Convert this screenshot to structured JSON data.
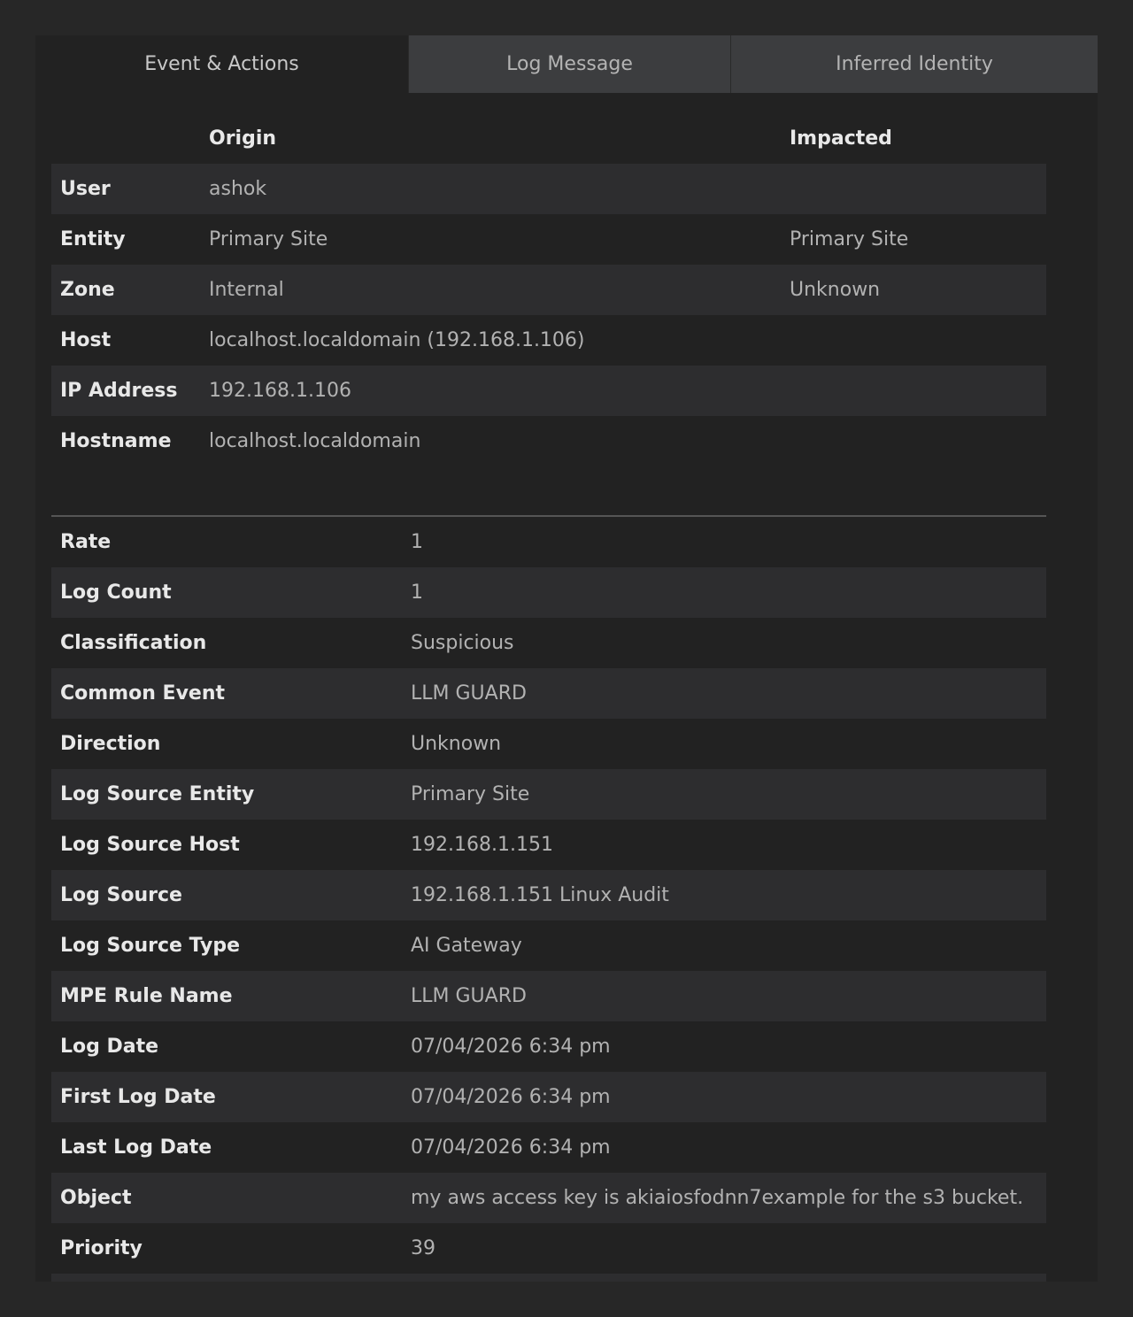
{
  "tabs": [
    {
      "label": "Event & Actions",
      "active": true
    },
    {
      "label": "Log Message",
      "active": false
    },
    {
      "label": "Inferred Identity",
      "active": false
    }
  ],
  "identity_table": {
    "headers": {
      "origin": "Origin",
      "impacted": "Impacted"
    },
    "rows": [
      {
        "label": "User",
        "origin": "ashok",
        "impacted": ""
      },
      {
        "label": "Entity",
        "origin": "Primary Site",
        "impacted": "Primary Site"
      },
      {
        "label": "Zone",
        "origin": "Internal",
        "impacted": "Unknown"
      },
      {
        "label": "Host",
        "origin": "localhost.localdomain (192.168.1.106)",
        "impacted": ""
      },
      {
        "label": "IP Address",
        "origin": "192.168.1.106",
        "impacted": ""
      },
      {
        "label": "Hostname",
        "origin": "localhost.localdomain",
        "impacted": ""
      }
    ]
  },
  "details_table": {
    "rows": [
      {
        "label": "Rate",
        "value": "1"
      },
      {
        "label": "Log Count",
        "value": "1"
      },
      {
        "label": "Classification",
        "value": "Suspicious"
      },
      {
        "label": "Common Event",
        "value": "LLM GUARD"
      },
      {
        "label": "Direction",
        "value": "Unknown"
      },
      {
        "label": "Log Source Entity",
        "value": "Primary Site"
      },
      {
        "label": "Log Source Host",
        "value": "192.168.1.151"
      },
      {
        "label": "Log Source",
        "value": "192.168.1.151 Linux Audit"
      },
      {
        "label": "Log Source Type",
        "value": "AI Gateway"
      },
      {
        "label": "MPE Rule Name",
        "value": "LLM GUARD"
      },
      {
        "label": "Log Date",
        "value": "07/04/2026 6:34 pm"
      },
      {
        "label": "First Log Date",
        "value": "07/04/2026 6:34 pm"
      },
      {
        "label": "Last Log Date",
        "value": "07/04/2026 6:34 pm"
      },
      {
        "label": "Object",
        "value": "my aws access key is akiaiosfodnn7example for the s3 bucket."
      },
      {
        "label": "Priority",
        "value": "39"
      },
      {
        "label": "",
        "value": ""
      }
    ]
  }
}
